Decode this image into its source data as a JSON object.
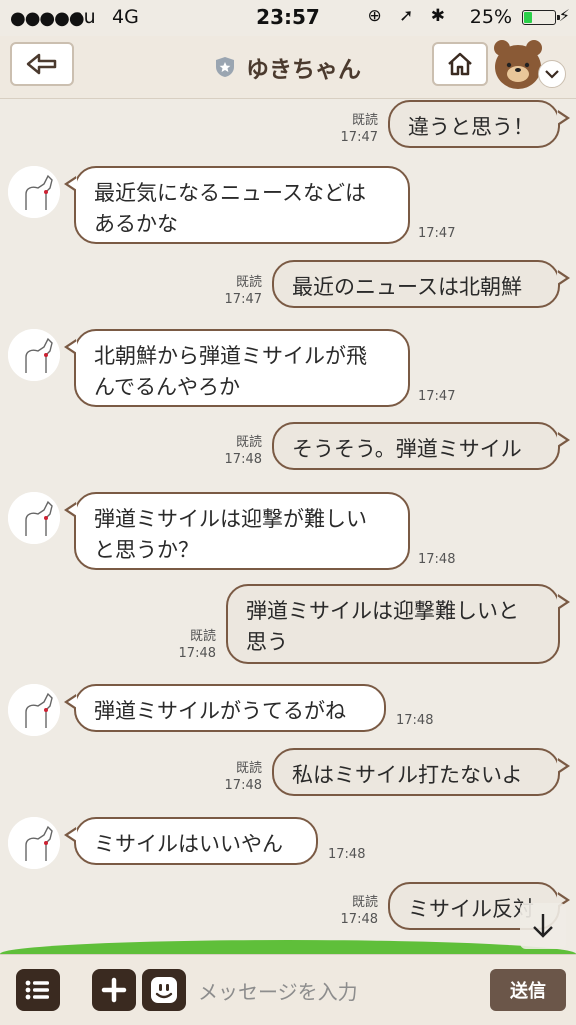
{
  "status_bar": {
    "signal": "●●●●●",
    "carrier": "au",
    "network": "4G",
    "time": "23:57",
    "battery_percent": "25%",
    "icons": "⊕ ➚ ✱"
  },
  "header": {
    "title": "ゆきちゃん"
  },
  "messages": [
    {
      "direction": "out",
      "text_lines": [
        "違うと思う！"
      ],
      "read": "既読",
      "time": "17:47"
    },
    {
      "direction": "in",
      "text_lines": [
        "最近気になるニュースなどは",
        "あるかな"
      ],
      "time": "17:47"
    },
    {
      "direction": "out",
      "text_lines": [
        "最近のニュースは北朝鮮"
      ],
      "read": "既読",
      "time": "17:47"
    },
    {
      "direction": "in",
      "text_lines": [
        "北朝鮮から弾道ミサイルが飛",
        "んでるんやろか"
      ],
      "time": "17:47"
    },
    {
      "direction": "out",
      "text_lines": [
        "そうそう。弾道ミサイル"
      ],
      "read": "既読",
      "time": "17:48"
    },
    {
      "direction": "in",
      "text_lines": [
        "弾道ミサイルは迎撃が難しい",
        "と思うか？"
      ],
      "time": "17:48"
    },
    {
      "direction": "out",
      "text_lines": [
        "弾道ミサイルは迎撃難しいと",
        "思う"
      ],
      "read": "既読",
      "time": "17:48"
    },
    {
      "direction": "in",
      "text_lines": [
        "弾道ミサイルがうてるがね"
      ],
      "time": "17:48"
    },
    {
      "direction": "out",
      "text_lines": [
        "私はミサイル打たないよ"
      ],
      "read": "既読",
      "time": "17:48"
    },
    {
      "direction": "in",
      "text_lines": [
        "ミサイルはいいやん"
      ],
      "time": "17:48"
    },
    {
      "direction": "out",
      "text_lines": [
        "ミサイル反対"
      ],
      "read": "既読",
      "time": "17:48"
    }
  ],
  "input_bar": {
    "placeholder": "メッセージを入力",
    "send_label": "送信"
  },
  "colors": {
    "background": "#efebe4",
    "bubble_border": "#7a5a44",
    "outgoing_bubble": "#ece7df",
    "send_button": "#6b5649",
    "icon_button": "#3a2a20"
  },
  "icons": {
    "back": "back-arrow-icon",
    "shield": "shield-star-icon",
    "home": "home-icon",
    "bear": "bear-avatar-icon",
    "favorite": "heart-chevron-icon",
    "menu": "menu-list-icon",
    "add": "plus-icon",
    "sticker": "smiley-icon",
    "scroll_down": "arrow-down-icon"
  }
}
